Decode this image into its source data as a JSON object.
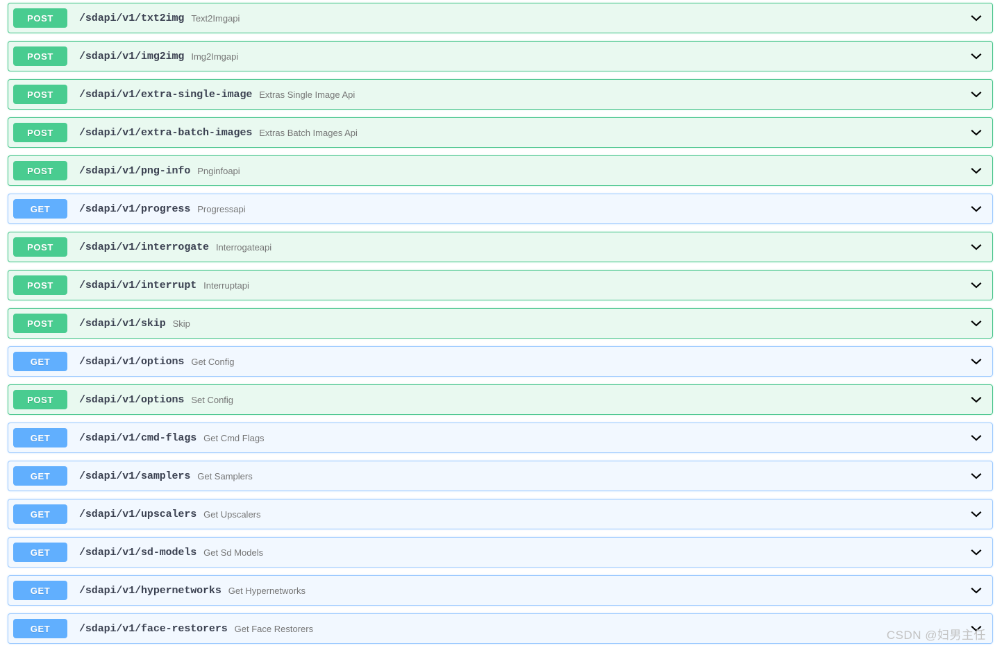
{
  "theme": {
    "page_background": "#ffffff",
    "get_accent": "#61affe",
    "get_row_background": "#f2f8ff",
    "get_row_border": "#9fcbff",
    "post_accent": "#49cc90",
    "post_row_background": "#e9f9f0",
    "post_row_border": "#4bc68e",
    "path_color": "#3b4151",
    "summary_color": "#767676"
  },
  "icons": {
    "expand": "chevron-down-icon"
  },
  "operations": [
    {
      "method": "POST",
      "path": "/sdapi/v1/txt2img",
      "summary": "Text2Imgapi"
    },
    {
      "method": "POST",
      "path": "/sdapi/v1/img2img",
      "summary": "Img2Imgapi"
    },
    {
      "method": "POST",
      "path": "/sdapi/v1/extra-single-image",
      "summary": "Extras Single Image Api"
    },
    {
      "method": "POST",
      "path": "/sdapi/v1/extra-batch-images",
      "summary": "Extras Batch Images Api"
    },
    {
      "method": "POST",
      "path": "/sdapi/v1/png-info",
      "summary": "Pnginfoapi"
    },
    {
      "method": "GET",
      "path": "/sdapi/v1/progress",
      "summary": "Progressapi"
    },
    {
      "method": "POST",
      "path": "/sdapi/v1/interrogate",
      "summary": "Interrogateapi"
    },
    {
      "method": "POST",
      "path": "/sdapi/v1/interrupt",
      "summary": "Interruptapi"
    },
    {
      "method": "POST",
      "path": "/sdapi/v1/skip",
      "summary": "Skip"
    },
    {
      "method": "GET",
      "path": "/sdapi/v1/options",
      "summary": "Get Config"
    },
    {
      "method": "POST",
      "path": "/sdapi/v1/options",
      "summary": "Set Config"
    },
    {
      "method": "GET",
      "path": "/sdapi/v1/cmd-flags",
      "summary": "Get Cmd Flags"
    },
    {
      "method": "GET",
      "path": "/sdapi/v1/samplers",
      "summary": "Get Samplers"
    },
    {
      "method": "GET",
      "path": "/sdapi/v1/upscalers",
      "summary": "Get Upscalers"
    },
    {
      "method": "GET",
      "path": "/sdapi/v1/sd-models",
      "summary": "Get Sd Models"
    },
    {
      "method": "GET",
      "path": "/sdapi/v1/hypernetworks",
      "summary": "Get Hypernetworks"
    },
    {
      "method": "GET",
      "path": "/sdapi/v1/face-restorers",
      "summary": "Get Face Restorers"
    }
  ],
  "watermark": {
    "text": "CSDN @妇男主任"
  }
}
